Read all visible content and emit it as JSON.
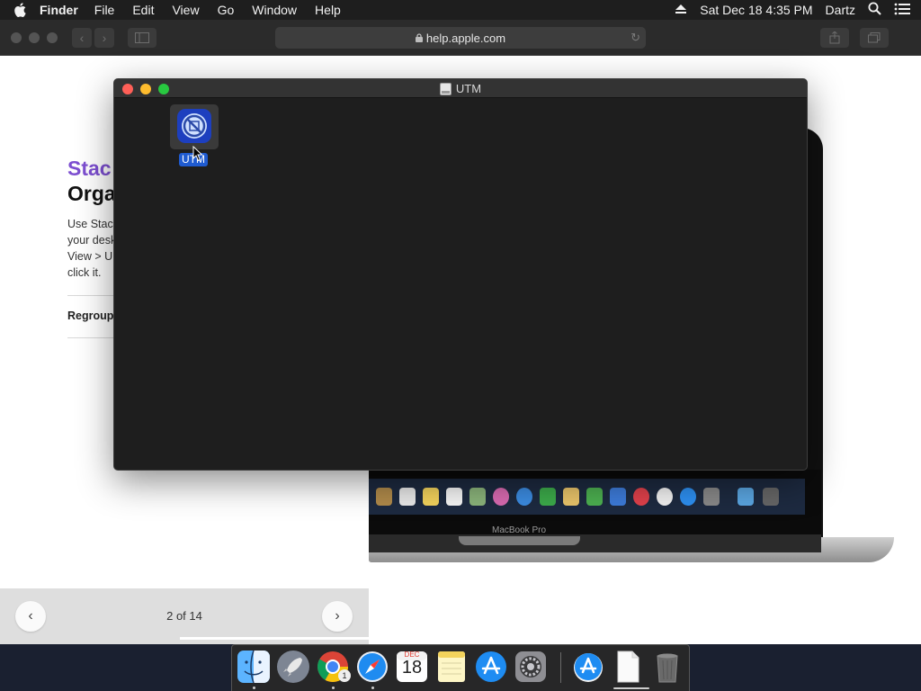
{
  "menubar": {
    "app_name": "Finder",
    "menus": [
      "File",
      "Edit",
      "View",
      "Go",
      "Window",
      "Help"
    ],
    "datetime": "Sat Dec 18  4:35 PM",
    "user": "Dartz"
  },
  "safari": {
    "url": "help.apple.com"
  },
  "article": {
    "title_line1": "Stac",
    "title_line2": "Orga",
    "body_lines": [
      "Use Stac",
      "your desk",
      "View > U",
      "click it."
    ],
    "section": "Regroup"
  },
  "macbook": {
    "label": "MacBook Pro"
  },
  "pager": {
    "prev": "‹",
    "next": "›",
    "count": "2 of 14"
  },
  "finder": {
    "title": "UTM",
    "file_label": "UTM"
  },
  "dock": {
    "calendar_month": "DEC",
    "calendar_day": "18",
    "chrome_badge": "1",
    "apps": [
      "Finder",
      "Launchpad",
      "Google Chrome",
      "Safari",
      "Calendar",
      "Notes",
      "App Store",
      "System Preferences",
      "App Store installer",
      "Document",
      "Trash"
    ]
  },
  "colors": {
    "accent_purple": "#7d4fd1",
    "selection_blue": "#1f5bd0",
    "traffic_red": "#ff5f57",
    "traffic_yellow": "#febc2e",
    "traffic_green": "#28c840"
  }
}
